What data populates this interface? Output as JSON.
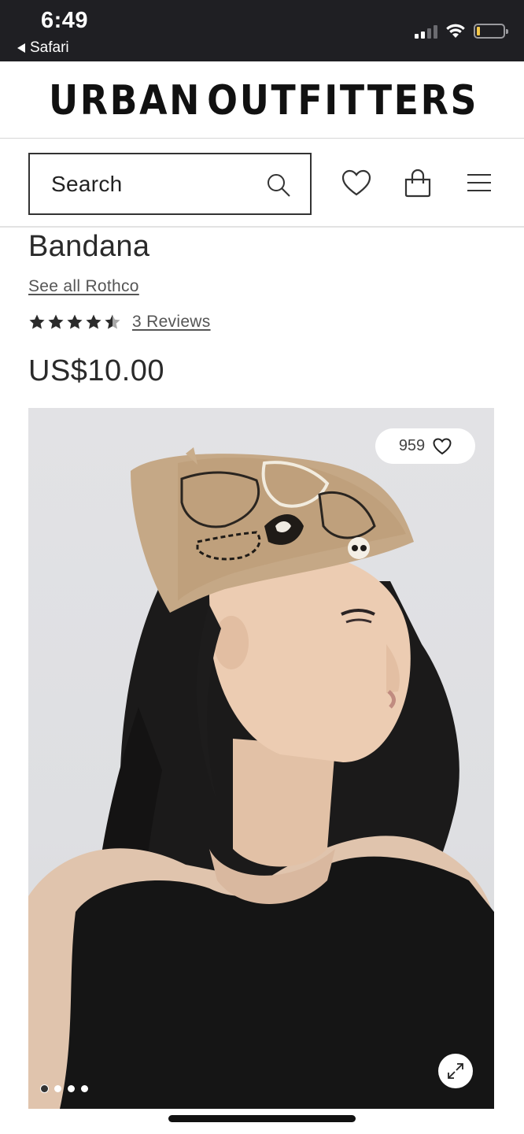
{
  "status_bar": {
    "time": "6:49",
    "back_app": "Safari",
    "battery_color": "#f5c84a"
  },
  "brand": {
    "logo_text_left": "URBAN",
    "logo_text_right": "OUTFITTERS"
  },
  "header": {
    "search_label": "Search",
    "icons": [
      "search-icon",
      "heart-icon",
      "shopping-bag-icon",
      "menu-icon"
    ]
  },
  "product": {
    "title": "Bandana",
    "brand_link": "See all Rothco",
    "rating": 4.5,
    "rating_max": 5,
    "reviews_link": "3 Reviews",
    "price": "US$10.00"
  },
  "gallery": {
    "like_count": "959",
    "image_count": 4,
    "active_index": 0,
    "icons": [
      "heart-icon",
      "expand-icon"
    ]
  },
  "colors": {
    "status_bar_bg": "#1f1f23",
    "text": "#2a2a2a",
    "link": "#555555"
  }
}
